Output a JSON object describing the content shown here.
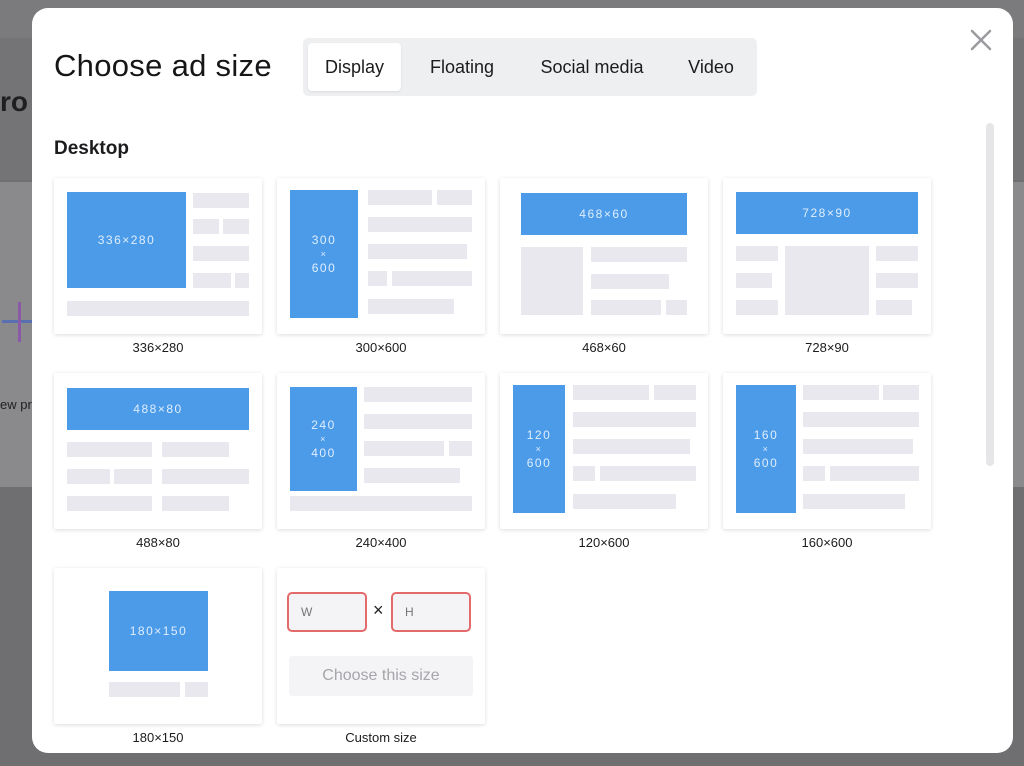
{
  "background": {
    "title_fragment": "ro",
    "caption_fragment": "ew pr"
  },
  "modal": {
    "title": "Choose ad size",
    "close_icon": "close-icon",
    "tabs": [
      {
        "label": "Display",
        "active": true
      },
      {
        "label": "Floating",
        "active": false
      },
      {
        "label": "Social media",
        "active": false
      },
      {
        "label": "Video",
        "active": false
      }
    ],
    "section": "Desktop",
    "cards": [
      {
        "ad_line1": "336×280",
        "ad_line2": "",
        "ad_line3": "",
        "label": "336×280"
      },
      {
        "ad_line1": "300",
        "ad_line2": "×",
        "ad_line3": "600",
        "label": "300×600"
      },
      {
        "ad_line1": "468×60",
        "ad_line2": "",
        "ad_line3": "",
        "label": "468×60"
      },
      {
        "ad_line1": "728×90",
        "ad_line2": "",
        "ad_line3": "",
        "label": "728×90"
      },
      {
        "ad_line1": "488×80",
        "ad_line2": "",
        "ad_line3": "",
        "label": "488×80"
      },
      {
        "ad_line1": "240",
        "ad_line2": "×",
        "ad_line3": "400",
        "label": "240×400"
      },
      {
        "ad_line1": "120",
        "ad_line2": "×",
        "ad_line3": "600",
        "label": "120×600"
      },
      {
        "ad_line1": "160",
        "ad_line2": "×",
        "ad_line3": "600",
        "label": "160×600"
      },
      {
        "ad_line1": "180×150",
        "ad_line2": "",
        "ad_line3": "",
        "label": "180×150"
      }
    ],
    "custom": {
      "width_placeholder": "W",
      "height_placeholder": "H",
      "times": "×",
      "button": "Choose this size",
      "label": "Custom size"
    }
  },
  "colors": {
    "ad_blue": "#4b9be8",
    "placeholder_gray": "#e8e8ee",
    "invalid_border": "#e46b6b"
  }
}
